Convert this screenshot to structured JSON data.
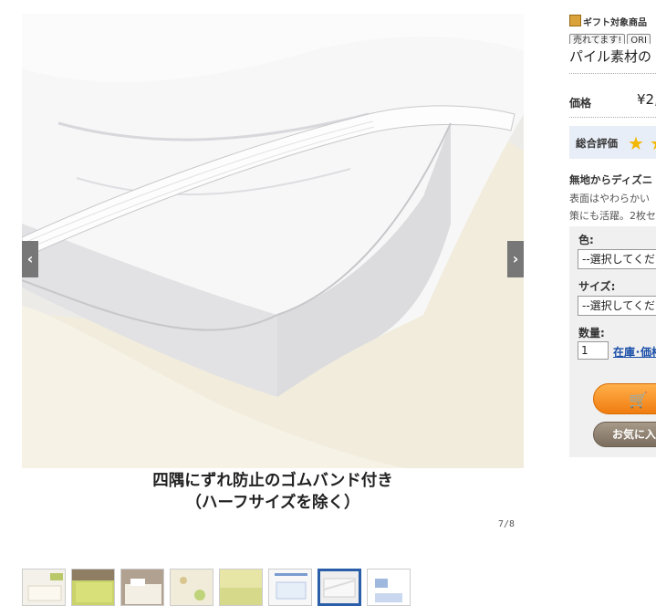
{
  "gallery": {
    "caption_line1": "四隅にずれ防止のゴムバンド付き",
    "caption_line2": "（ハーフサイズを除く）",
    "counter": "7/8",
    "prev_arrow": "‹",
    "next_arrow": "›",
    "thumbnail_count": 8,
    "active_thumbnail": 7
  },
  "product": {
    "gift_label": "ギフト対象商品",
    "badges": [
      "売れてます!",
      "ORI"
    ],
    "title": "パイル素材の",
    "price_label": "価格",
    "price_value": "¥2,",
    "rating_label": "総合評価",
    "desc_heading": "無地からディズニ",
    "desc_lines": [
      "表面はやわらかい",
      "策にも活躍。2枚セ"
    ]
  },
  "options": {
    "color_label": "色:",
    "color_value": "--選択してくだ",
    "size_label": "サイズ:",
    "size_value": "--選択してくだ",
    "qty_label": "数量:",
    "qty_value": "1",
    "stock_link": "在庫･価格",
    "fav_button": "お気に入",
    "cart_icon": "cart-icon"
  },
  "colors": {
    "accent_orange": "#f07c10",
    "link_blue": "#1a4fa8",
    "rating_bg": "#e8eef7",
    "panel_bg": "#f0f0f0"
  }
}
